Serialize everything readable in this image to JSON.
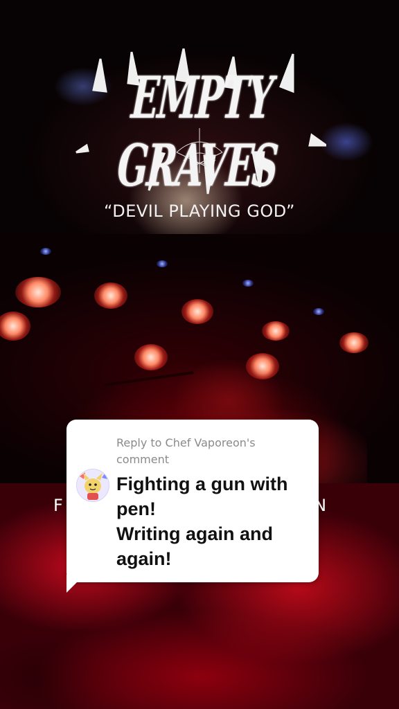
{
  "overlay": {
    "band_logo_text": "EMPTY GRAVES",
    "song_title": "“DEVIL PLAYING GOD”",
    "lyric_left": "F",
    "lyric_right": "EN"
  },
  "reply_bubble": {
    "reply_label": "Reply to Chef Vaporeon's comment",
    "avatar_icon": "user-avatar-icon",
    "comment_lines": [
      "Fighting a gun with pen!",
      "Writing again and again!"
    ]
  },
  "colors": {
    "bubble_bg": "#ffffff",
    "reply_label": "#8a8a8a",
    "comment_text": "#111111",
    "stage_red": "#c8001e"
  }
}
